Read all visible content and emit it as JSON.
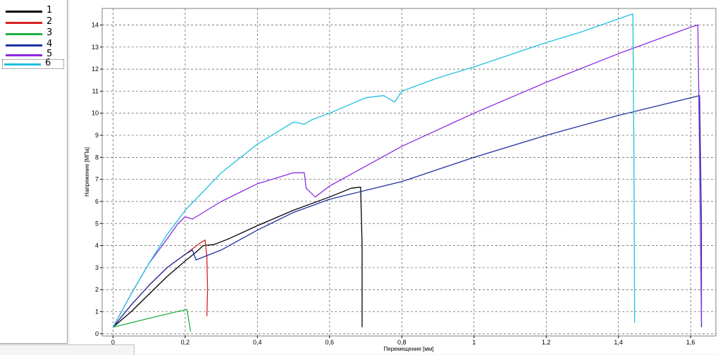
{
  "chart_data": {
    "type": "line",
    "xlabel": "Перемещение [мм]",
    "ylabel": "Напряжение [МПа]",
    "xlim": [
      -0.03,
      1.67
    ],
    "ylim": [
      -0.1,
      14.75
    ],
    "x_ticks": [
      {
        "value": 0,
        "label": "0"
      },
      {
        "value": 0.2,
        "label": "0,2"
      },
      {
        "value": 0.4,
        "label": "0,4"
      },
      {
        "value": 0.6,
        "label": "0,6"
      },
      {
        "value": 0.8,
        "label": "0,8"
      },
      {
        "value": 1.0,
        "label": "1"
      },
      {
        "value": 1.2,
        "label": "1,2"
      },
      {
        "value": 1.4,
        "label": "1,4"
      },
      {
        "value": 1.6,
        "label": "1,6"
      }
    ],
    "y_ticks": [
      0,
      1,
      2,
      3,
      4,
      5,
      6,
      7,
      8,
      9,
      10,
      11,
      12,
      13,
      14
    ],
    "grid": true,
    "legend_position": "left-panel",
    "series": [
      {
        "name": "1",
        "color": "#000000",
        "x": [
          0,
          0.05,
          0.1,
          0.15,
          0.2,
          0.23,
          0.25,
          0.28,
          0.32,
          0.4,
          0.5,
          0.6,
          0.66,
          0.686,
          0.69,
          0.69
        ],
        "y": [
          0.3,
          1.0,
          1.8,
          2.6,
          3.3,
          3.7,
          4.0,
          4.05,
          4.3,
          4.9,
          5.6,
          6.2,
          6.6,
          6.65,
          4.0,
          0.3
        ]
      },
      {
        "name": "2",
        "color": "#d42020",
        "x": [
          0,
          0.05,
          0.1,
          0.15,
          0.2,
          0.24,
          0.255,
          0.26,
          0.262,
          0.26
        ],
        "y": [
          0.3,
          1.3,
          2.2,
          3.0,
          3.6,
          4.1,
          4.25,
          3.5,
          2.0,
          0.8
        ]
      },
      {
        "name": "3",
        "color": "#20b040",
        "x": [
          0,
          0.05,
          0.1,
          0.15,
          0.19,
          0.205,
          0.21,
          0.215
        ],
        "y": [
          0.3,
          0.5,
          0.7,
          0.9,
          1.05,
          1.1,
          0.6,
          0.1
        ]
      },
      {
        "name": "4",
        "color": "#2030a0",
        "x": [
          0,
          0.05,
          0.1,
          0.15,
          0.2,
          0.22,
          0.23,
          0.3,
          0.4,
          0.5,
          0.6,
          0.7,
          0.8,
          1.0,
          1.2,
          1.4,
          1.55,
          1.625,
          1.63,
          1.63
        ],
        "y": [
          0.3,
          1.3,
          2.2,
          3.0,
          3.6,
          3.8,
          3.35,
          3.8,
          4.7,
          5.5,
          6.1,
          6.5,
          6.9,
          8.0,
          9.0,
          9.9,
          10.5,
          10.8,
          5.0,
          0.3
        ]
      },
      {
        "name": "5",
        "color": "#8a2be2",
        "x": [
          0,
          0.05,
          0.1,
          0.15,
          0.18,
          0.2,
          0.22,
          0.3,
          0.4,
          0.5,
          0.53,
          0.535,
          0.56,
          0.6,
          0.8,
          1.0,
          1.2,
          1.4,
          1.6,
          1.62,
          1.625,
          1.63
        ],
        "y": [
          0.3,
          1.8,
          3.2,
          4.3,
          5.0,
          5.3,
          5.2,
          6.0,
          6.8,
          7.3,
          7.3,
          6.6,
          6.2,
          6.7,
          8.5,
          10.0,
          11.4,
          12.7,
          13.9,
          14.0,
          8.0,
          0.5
        ]
      },
      {
        "name": "6",
        "color": "#20c0e0",
        "x": [
          0,
          0.05,
          0.1,
          0.15,
          0.2,
          0.3,
          0.4,
          0.5,
          0.53,
          0.55,
          0.6,
          0.7,
          0.75,
          0.78,
          0.8,
          0.9,
          1.0,
          1.2,
          1.3,
          1.43,
          1.44,
          1.443,
          1.445
        ],
        "y": [
          0.3,
          1.8,
          3.2,
          4.5,
          5.6,
          7.3,
          8.6,
          9.6,
          9.5,
          9.7,
          10.0,
          10.7,
          10.8,
          10.5,
          11.0,
          11.6,
          12.1,
          13.2,
          13.7,
          14.45,
          14.5,
          8.0,
          0.5
        ]
      }
    ]
  },
  "legend": {
    "items": [
      {
        "label": "1",
        "color": "#000000"
      },
      {
        "label": "2",
        "color": "#d42020"
      },
      {
        "label": "3",
        "color": "#20b040"
      },
      {
        "label": "4",
        "color": "#2030a0"
      },
      {
        "label": "5",
        "color": "#8a2be2"
      },
      {
        "label": "6",
        "color": "#20c0e0"
      }
    ]
  }
}
